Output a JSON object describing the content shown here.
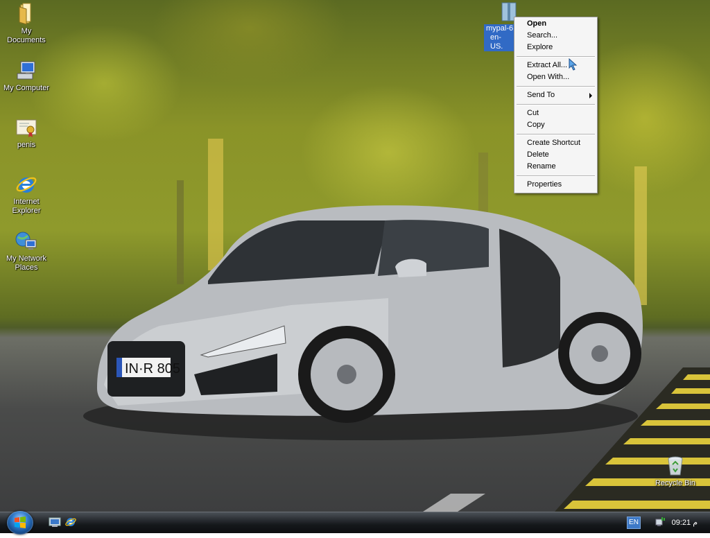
{
  "desktop": {
    "icons": [
      {
        "label": "My Documents"
      },
      {
        "label": "My Computer"
      },
      {
        "label": "penis"
      },
      {
        "label": "Internet Explorer"
      },
      {
        "label": "My Network Places"
      },
      {
        "label": "Recycle Bin"
      }
    ],
    "selected_file": {
      "line1": "mypal-6",
      "line2": "en-US."
    }
  },
  "context_menu": {
    "items": [
      {
        "label": "Open"
      },
      {
        "label": "Search..."
      },
      {
        "label": "Explore"
      },
      {
        "label": "Extract All..."
      },
      {
        "label": "Open With..."
      },
      {
        "label": "Send To"
      },
      {
        "label": "Cut"
      },
      {
        "label": "Copy"
      },
      {
        "label": "Create Shortcut"
      },
      {
        "label": "Delete"
      },
      {
        "label": "Rename"
      },
      {
        "label": "Properties"
      }
    ]
  },
  "taskbar": {
    "language": "EN",
    "clock": "09:21 م"
  },
  "icons": {
    "start": "windows-logo-icon",
    "quick_launch": [
      "show-desktop-icon",
      "internet-explorer-icon"
    ],
    "tray": [
      "network-icon"
    ]
  },
  "colors": {
    "selection": "#316ac5",
    "taskbar": "#15181b",
    "menu_bg": "#f5f5f5"
  }
}
